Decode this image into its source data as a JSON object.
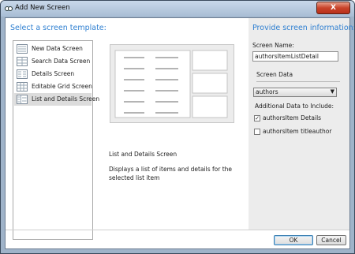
{
  "window": {
    "title": "Add New Screen",
    "close_label": "X"
  },
  "templates": {
    "heading": "Select a screen template:",
    "items": [
      {
        "label": "New Data Screen",
        "icon": "form-screen-icon"
      },
      {
        "label": "Search Data Screen",
        "icon": "grid-screen-icon"
      },
      {
        "label": "Details Screen",
        "icon": "details-screen-icon"
      },
      {
        "label": "Editable Grid Screen",
        "icon": "editable-grid-icon"
      },
      {
        "label": "List and Details Screen",
        "icon": "list-details-icon"
      }
    ],
    "selected": "List and Details Screen"
  },
  "description": {
    "title": "List and Details Screen",
    "body": "Displays a list of items and details for the selected list item"
  },
  "info": {
    "heading": "Provide screen information:",
    "screen_name_label": "Screen Name:",
    "screen_name_value": "authorsItemListDetail",
    "screen_data_label": "Screen Data",
    "screen_data_value": "authors",
    "additional_label": "Additional Data to Include:",
    "options": [
      {
        "label": "authorsItem Details",
        "checked": true
      },
      {
        "label": "authorsItem titleauthor",
        "checked": false
      }
    ]
  },
  "footer": {
    "ok_label": "OK",
    "cancel_label": "Cancel"
  },
  "colors": {
    "heading": "#2e7fd1",
    "titlebar": "#b4c7dc",
    "close": "#c9432a",
    "selected_item": "#dcdcdc"
  }
}
